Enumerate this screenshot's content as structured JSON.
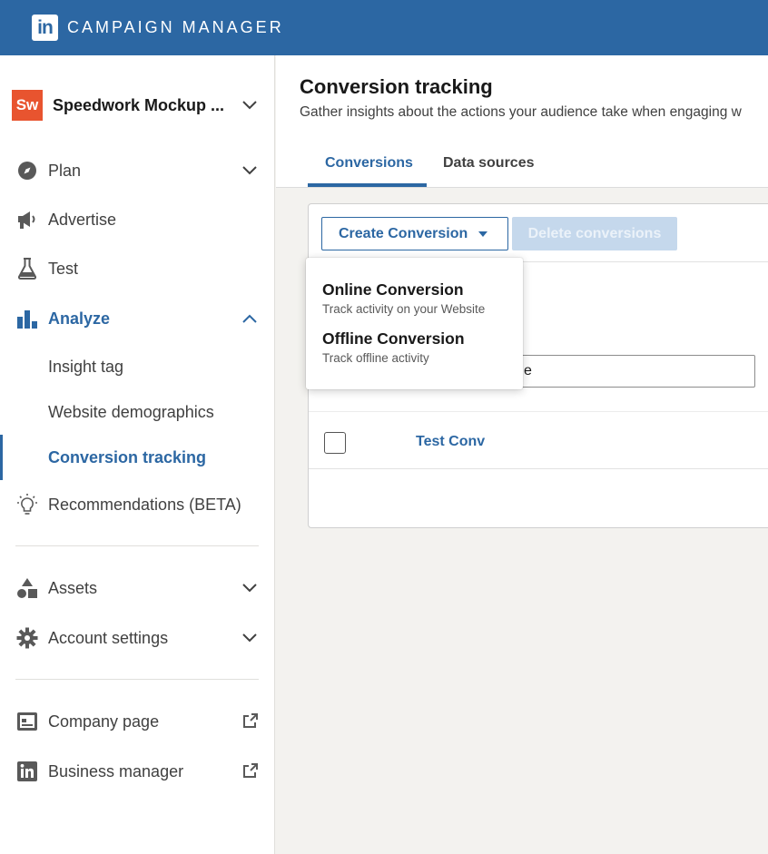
{
  "app": {
    "brand": "CAMPAIGN MANAGER",
    "logo_text": "in"
  },
  "account": {
    "logo_text": "Sw",
    "name": "Speedwork Mockup ..."
  },
  "nav": {
    "plan": "Plan",
    "advertise": "Advertise",
    "test": "Test",
    "analyze": "Analyze",
    "insight_tag": "Insight tag",
    "website_demographics": "Website demographics",
    "conversion_tracking": "Conversion tracking",
    "recommendations": "Recommendations (BETA)",
    "assets": "Assets",
    "account_settings": "Account settings",
    "company_page": "Company page",
    "business_manager": "Business manager"
  },
  "page": {
    "title": "Conversion tracking",
    "subtitle": "Gather insights about the actions your audience take when engaging w"
  },
  "tabs": [
    {
      "label": "Conversions",
      "active": true
    },
    {
      "label": "Data sources",
      "active": false
    }
  ],
  "toolbar": {
    "create_label": "Create Conversion",
    "delete_label": "Delete conversions"
  },
  "search": {
    "value": "e"
  },
  "table": {
    "rows": [
      {
        "name": "Test Conv"
      }
    ]
  },
  "dropdown": {
    "items": [
      {
        "title": "Online Conversion",
        "desc": "Track activity on your Website"
      },
      {
        "title": "Offline Conversion",
        "desc": "Track offline activity"
      }
    ]
  },
  "colors": {
    "brand_blue": "#2c67a3",
    "account_logo": "#e8542f",
    "disabled_button": "#c5d8ec"
  }
}
